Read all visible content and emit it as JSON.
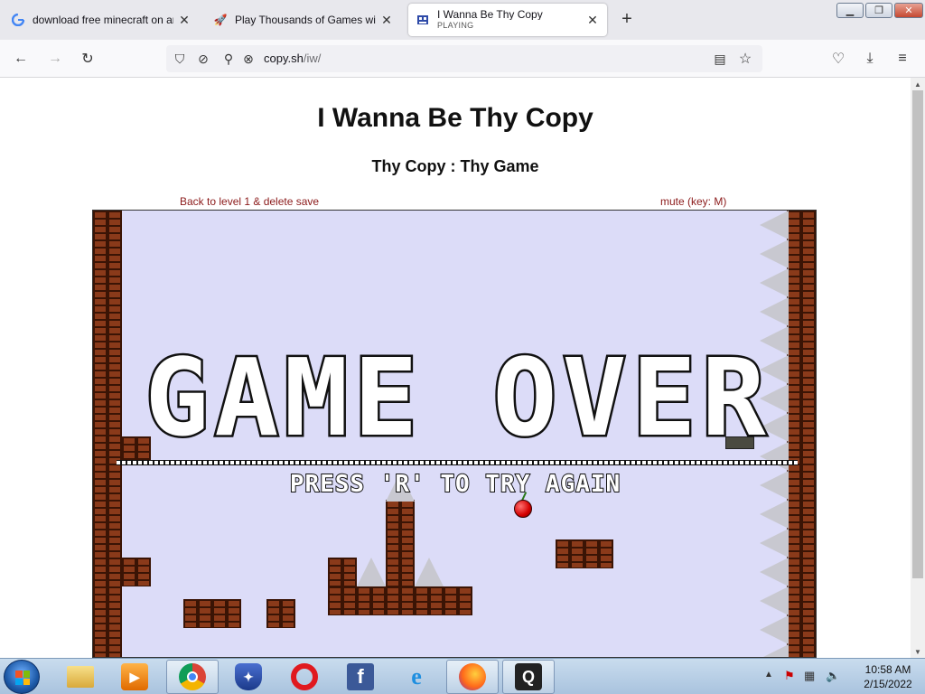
{
  "browser": {
    "tabs": [
      {
        "title": "download free minecraft on ara",
        "favicon": "google-icon",
        "active": false
      },
      {
        "title": "Play Thousands of Games with",
        "favicon": "rocket-icon",
        "active": false
      },
      {
        "title": "I Wanna Be Thy Copy",
        "subtitle": "PLAYING",
        "favicon": "game-icon",
        "active": true
      }
    ],
    "new_tab": "+",
    "url_host": "copy.sh",
    "url_path": "/iw/"
  },
  "page": {
    "title": "I Wanna Be Thy Copy",
    "subtitle": "Thy Copy : Thy Game",
    "back_link": "Back to level 1 & delete save",
    "mute_link": "mute (key: M)"
  },
  "game": {
    "game_over_text": "GAME OVER",
    "press_r_text": "PRESS 'R' TO TRY AGAIN"
  },
  "taskbar": {
    "clock_time": "10:58 AM",
    "clock_date": "2/15/2022",
    "apps": [
      "explorer-icon",
      "media-player-icon",
      "chrome-icon",
      "shield-app-icon",
      "opera-icon",
      "facebook-icon",
      "internet-explorer-icon",
      "firefox-icon",
      "q-app-icon"
    ]
  },
  "colors": {
    "game_bg": "#dcdcf8",
    "brick": "#8a3a1a",
    "link": "#8b1a1a"
  }
}
